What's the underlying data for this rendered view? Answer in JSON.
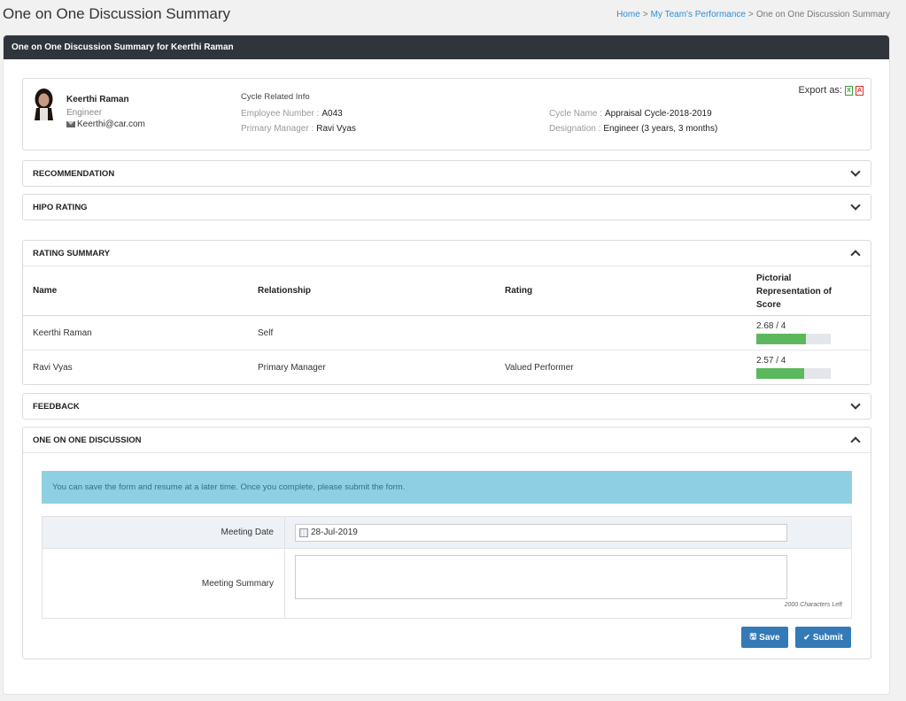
{
  "page": {
    "title": "One on One Discussion Summary",
    "breadcrumb": {
      "home": "Home",
      "sep1": ">",
      "team": "My Team's Performance",
      "sep2": ">",
      "current": "One on One Discussion Summary"
    }
  },
  "portlet": {
    "title": "One on One Discussion Summary for Keerthi Raman"
  },
  "employee": {
    "name": "Keerthi Raman",
    "role": "Engineer",
    "email": "Keerthi@car.com",
    "cycle_info_title": "Cycle Related Info",
    "employee_number_label": "Employee Number :",
    "employee_number": "A043",
    "primary_manager_label": "Primary Manager :",
    "primary_manager": "Ravi Vyas",
    "cycle_name_label": "Cycle Name :",
    "cycle_name": "Appraisal Cycle-2018-2019",
    "designation_label": "Designation :",
    "designation": "Engineer (3 years, 3 months)",
    "export_label": "Export as:",
    "export_xls_glyph": "X",
    "export_pdf_glyph": "A"
  },
  "sections": {
    "recommendation": "RECOMMENDATION",
    "hipo": "HIPO RATING",
    "rating_summary": "RATING SUMMARY",
    "feedback": "FEEDBACK",
    "one_on_one": "ONE ON ONE DISCUSSION"
  },
  "rating_table": {
    "headers": {
      "name": "Name",
      "relationship": "Relationship",
      "rating": "Rating",
      "pictorial_1": "Pictorial",
      "pictorial_2": "Representation of",
      "pictorial_3": "Score"
    },
    "rows": [
      {
        "name": "Keerthi Raman",
        "relationship": "Self",
        "rating": "",
        "score_text": "2.68 / 4",
        "score": 2.68,
        "max": 4
      },
      {
        "name": "Ravi Vyas",
        "relationship": "Primary Manager",
        "rating": "Valued Performer",
        "score_text": "2.57 / 4",
        "score": 2.57,
        "max": 4
      }
    ]
  },
  "discussion": {
    "alert": "You can save the form and resume at a later time. Once you complete, please submit the form.",
    "meeting_date_label": "Meeting Date",
    "meeting_date": "28-Jul-2019",
    "meeting_summary_label": "Meeting Summary",
    "meeting_summary": "",
    "chars_left": "2000 Characters Left",
    "save_label": "Save",
    "submit_label": "Submit"
  },
  "colors": {
    "header_dark": "#2f353b",
    "link": "#2a8fd6",
    "score_bar": "#5cb85c",
    "alert_bg": "#8fcfe3",
    "button": "#337ab7"
  },
  "icons": [
    "envelope-icon",
    "excel-icon",
    "pdf-icon",
    "chevron-down-icon",
    "chevron-up-icon",
    "calendar-icon",
    "save-icon",
    "check-circle-icon"
  ]
}
